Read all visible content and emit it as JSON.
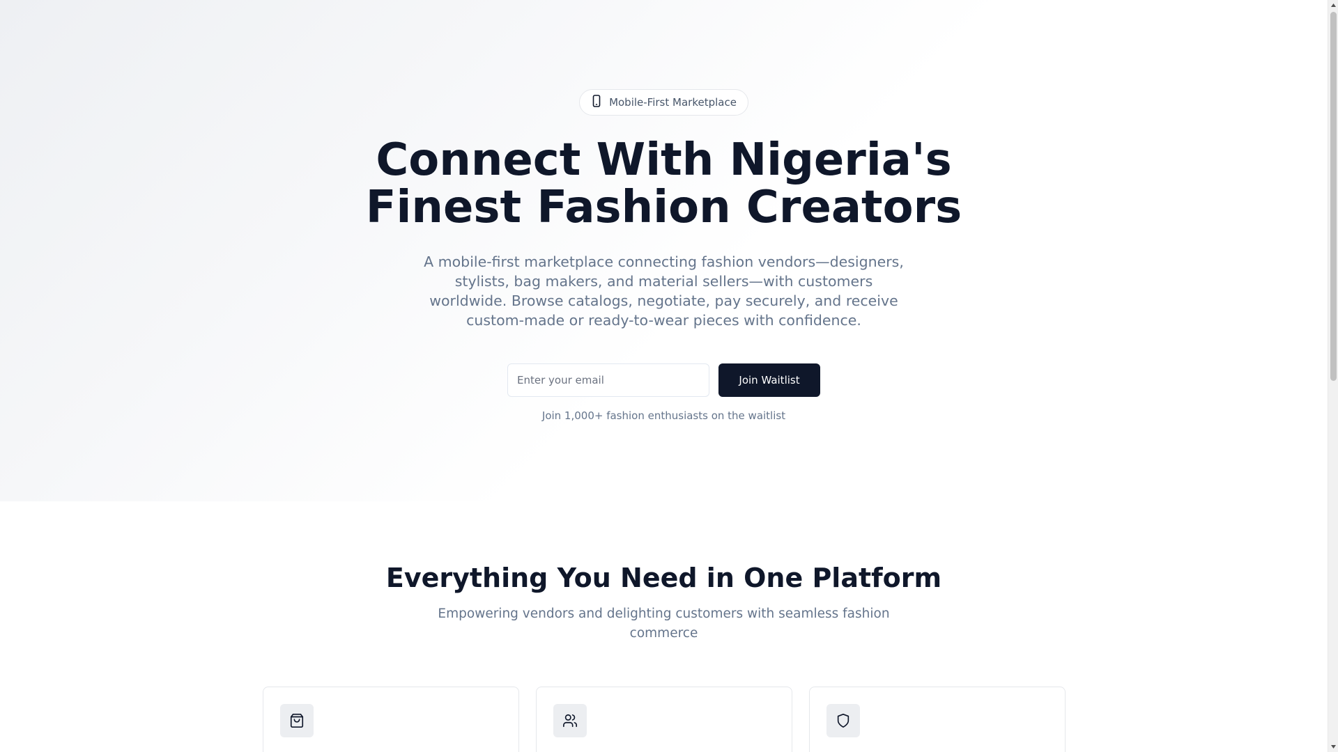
{
  "hero": {
    "badge_icon": "smartphone-icon",
    "badge_label": "Mobile-First Marketplace",
    "title_line1": "Connect With Nigeria's",
    "title_line2": "Finest Fashion Creators",
    "subtitle": "A mobile-first marketplace connecting fashion vendors—designers, stylists, bag makers, and material sellers—with customers worldwide. Browse catalogs, negotiate, pay securely, and receive custom-made or ready-to-wear pieces with confidence.",
    "email_placeholder": "Enter your email",
    "email_value": "",
    "join_button_label": "Join Waitlist",
    "waitlist_note": "Join 1,000+ fashion enthusiasts on the waitlist"
  },
  "features": {
    "title": "Everything You Need in One Platform",
    "subtitle": "Empowering vendors and delighting customers with seamless fashion commerce",
    "cards": [
      {
        "icon": "shopping-bag-icon"
      },
      {
        "icon": "users-icon"
      },
      {
        "icon": "shield-icon"
      }
    ]
  },
  "colors": {
    "primary": "#0f172a",
    "muted_text": "#64748b",
    "border": "#e5e7eb",
    "icon_tile": "#eceef1"
  }
}
